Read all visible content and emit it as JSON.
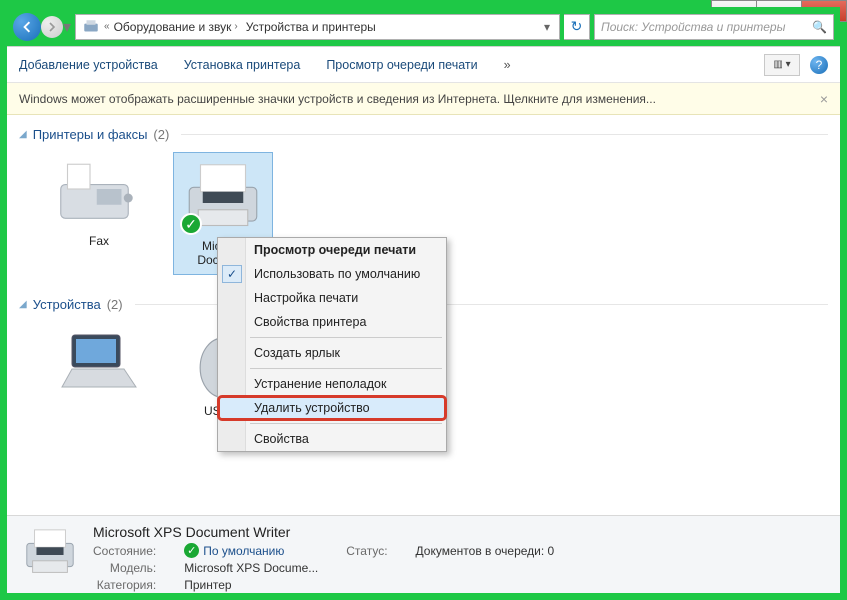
{
  "window": {
    "caption_min": "–",
    "caption_max": "▢",
    "caption_close": "✕"
  },
  "nav": {
    "breadcrumb_sep": "›",
    "seg1": "Оборудование и звук",
    "seg2": "Устройства и принтеры",
    "dropdown": "▾",
    "refresh": "↻",
    "search_placeholder": "Поиск: Устройства и принтеры",
    "search_icon": "🔍"
  },
  "toolbar": {
    "add_device": "Добавление устройства",
    "add_printer": "Установка принтера",
    "view_queue": "Просмотр очереди печати",
    "more": "»",
    "view_menu_glyph": "▥ ▾",
    "help": "?"
  },
  "banner": {
    "text": "Windows может отображать расширенные значки устройств и сведения из Интернета.  Щелкните для изменения...",
    "close": "×"
  },
  "groups": {
    "printers": {
      "title": "Принтеры и факсы",
      "count": "(2)"
    },
    "devices": {
      "title": "Устройства",
      "count": "(2)"
    }
  },
  "devices": {
    "fax": {
      "label": "Fax"
    },
    "xps": {
      "label_line1": "Microsoft XPS",
      "label_line2": "Document Writer",
      "label_truncated1": "Microso",
      "label_truncated2": "Documen"
    },
    "laptop": {
      "label": ""
    },
    "mouse": {
      "label": "USB Mouse",
      "label_truncated": "USB M"
    }
  },
  "context_menu": {
    "view_queue": "Просмотр очереди печати",
    "set_default": "Использовать по умолчанию",
    "print_setup": "Настройка печати",
    "printer_props": "Свойства принтера",
    "create_shortcut": "Создать ярлык",
    "troubleshoot": "Устранение неполадок",
    "remove_device": "Удалить устройство",
    "properties": "Свойства",
    "check": "✓"
  },
  "details": {
    "title": "Microsoft XPS Document Writer",
    "state_label": "Состояние:",
    "state_value": "По умолчанию",
    "model_label": "Модель:",
    "model_value": "Microsoft XPS Docume...",
    "category_label": "Категория:",
    "category_value": "Принтер",
    "status_label": "Статус:",
    "status_value": "Документов в очереди: 0"
  }
}
